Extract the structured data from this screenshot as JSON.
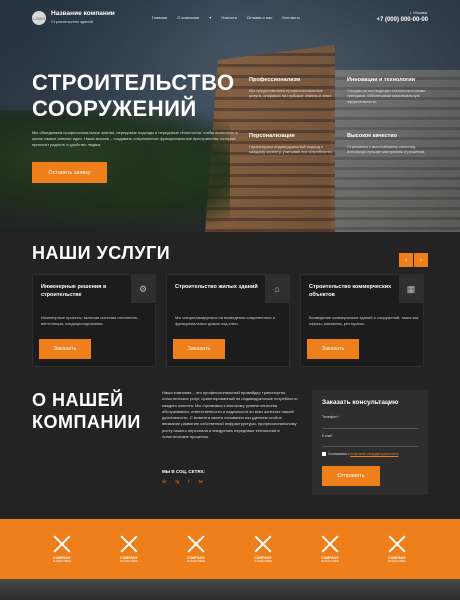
{
  "header": {
    "logo_text": "LOGO",
    "company_name": "Название компании",
    "company_sub": "Строительство зданий",
    "nav": [
      "Главная",
      "О компании",
      "▾",
      "Новости",
      "Отзывы о нас",
      "Контакты"
    ],
    "city": "г. Москва",
    "phone": "+7 (000) 000-00-00"
  },
  "hero": {
    "title_line1": "СТРОИТЕЛЬСТВО",
    "title_line2": "СООРУЖЕНИЙ",
    "description": "Мы объединяем профессиональные знания, передовые подходы и передовые технологии, чтобы воплотить в жизнь самые смелые идеи. Наша миссия – создавать современные функциональные пространства, которые приносят радость и удобство людям.",
    "button": "Оставить заявку",
    "features": [
      {
        "title": "Профессионализм",
        "text": "Мы предоставляем профессиональные услуги, опираясь на глубокие знания и опыт."
      },
      {
        "title": "Инновации и технологии",
        "text": "Следим за последними технологическими трендами, обеспечивая максимальную эффективность."
      },
      {
        "title": "Персонализация",
        "text": "Гарантируем индивидуальный подход к каждому клиенту, учитывая его потребности."
      },
      {
        "title": "Высокое качество",
        "text": "Стремимся к высочайшему качеству, используя лучшие материалы и решения."
      }
    ]
  },
  "services": {
    "title": "НАШИ УСЛУГИ",
    "prev": "‹",
    "next": "›",
    "cards": [
      {
        "title": "Инженерные решения в строительстве",
        "text": "Инженерные проекты, включая системы отопления, вентиляции, кондиционирования.",
        "button": "Заказать",
        "icon": "engineer-icon"
      },
      {
        "title": "Строительство жилых зданий",
        "text": "Мы специализируемся на возведении современных и функциональных домов под ключ.",
        "button": "Заказать",
        "icon": "house-plan-icon"
      },
      {
        "title": "Строительство коммерческих объектов",
        "text": "Возведение коммерческих зданий и сооружений, таких как офисы, магазины, рестораны.",
        "button": "Заказать",
        "icon": "commercial-building-icon"
      }
    ]
  },
  "about": {
    "title_line1": "О НАШЕЙ",
    "title_line2": "КОМПАНИИ",
    "text": "Наша компания – это профессиональный провайдер транспортно-логистических услуг, ориентированный на индивидуальные потребности каждого клиента. Мы стремимся к высокому уровню качества обслуживания, ответственности и надежности во всех аспектах нашей деятельности. С момента своего основания мы уделяем особое внимание развитию собственной инфраструктуры, профессиональному росту нашего персонала и внедрению передовых технологий в логистические процессы.",
    "social_title": "МЫ В СОЦ. СЕТЯХ:",
    "social": [
      "vk",
      "tg",
      "f",
      "tw"
    ]
  },
  "form": {
    "title": "Заказать консультацию",
    "phone_label": "Телефон *",
    "email_label": "E-mail",
    "agree_text": "Соглашаюсь с ",
    "agree_link": "политикой конфиденциальности",
    "submit": "Отправить"
  },
  "partners": {
    "items": [
      {
        "name": "COMPANY",
        "tagline": "SLOGAN HERE"
      },
      {
        "name": "COMPANY",
        "tagline": "SLOGAN HERE"
      },
      {
        "name": "COMPANY",
        "tagline": "SLOGAN HERE"
      },
      {
        "name": "COMPANY",
        "tagline": "SLOGAN HERE"
      },
      {
        "name": "COMPANY",
        "tagline": "SLOGAN HERE"
      },
      {
        "name": "COMPANY",
        "tagline": "SLOGAN HERE"
      }
    ]
  },
  "colors": {
    "accent": "#ee7f1a",
    "bg": "#232323"
  }
}
